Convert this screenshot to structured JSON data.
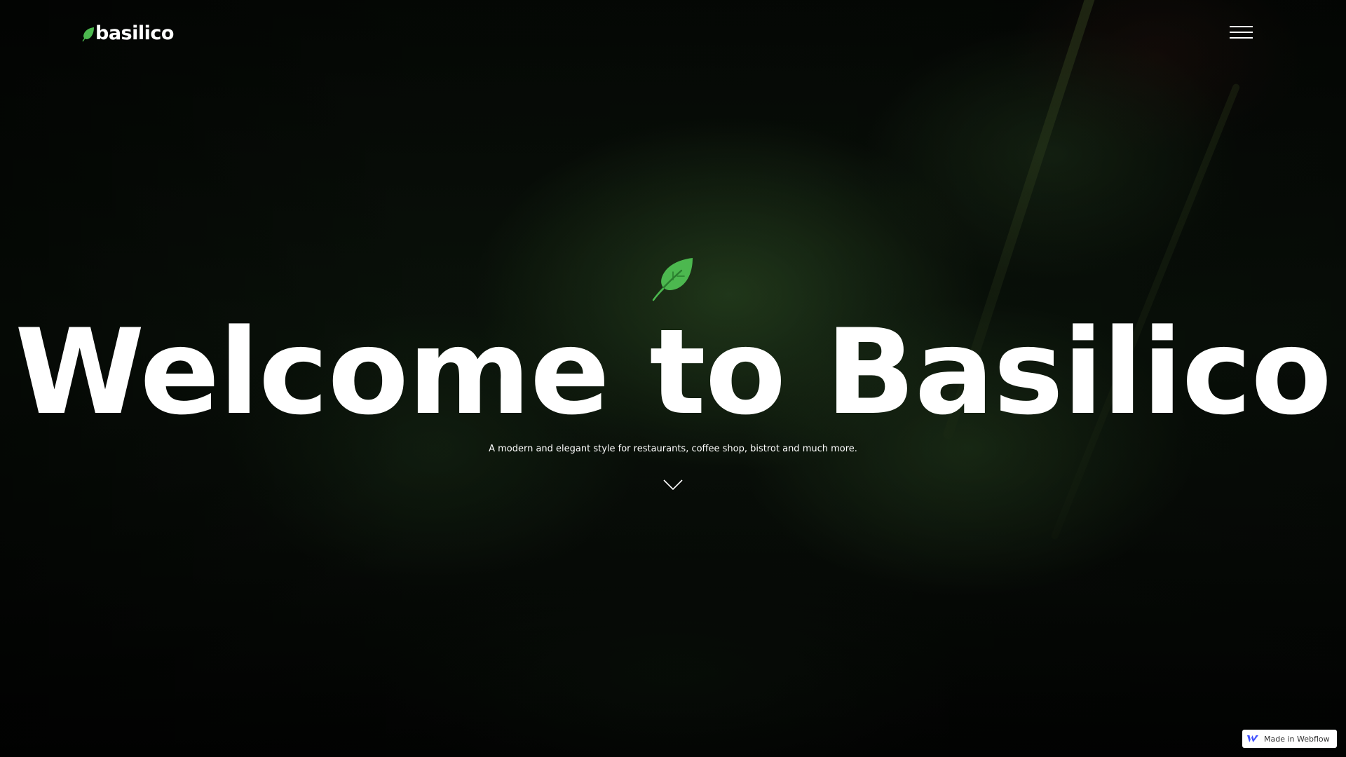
{
  "brand": {
    "name": "basilico",
    "accent_color": "#4cb84f"
  },
  "nav": {
    "menu_icon": "hamburger-menu-icon"
  },
  "hero": {
    "icon": "leaf-icon",
    "title": "Welcome to Basilico",
    "subtitle": "A modern and elegant style for restaurants, coffee shop, bistrot and much more.",
    "scroll_icon": "chevron-down-icon"
  },
  "badge": {
    "label": "Made in Webflow",
    "icon": "webflow-logo-icon"
  }
}
